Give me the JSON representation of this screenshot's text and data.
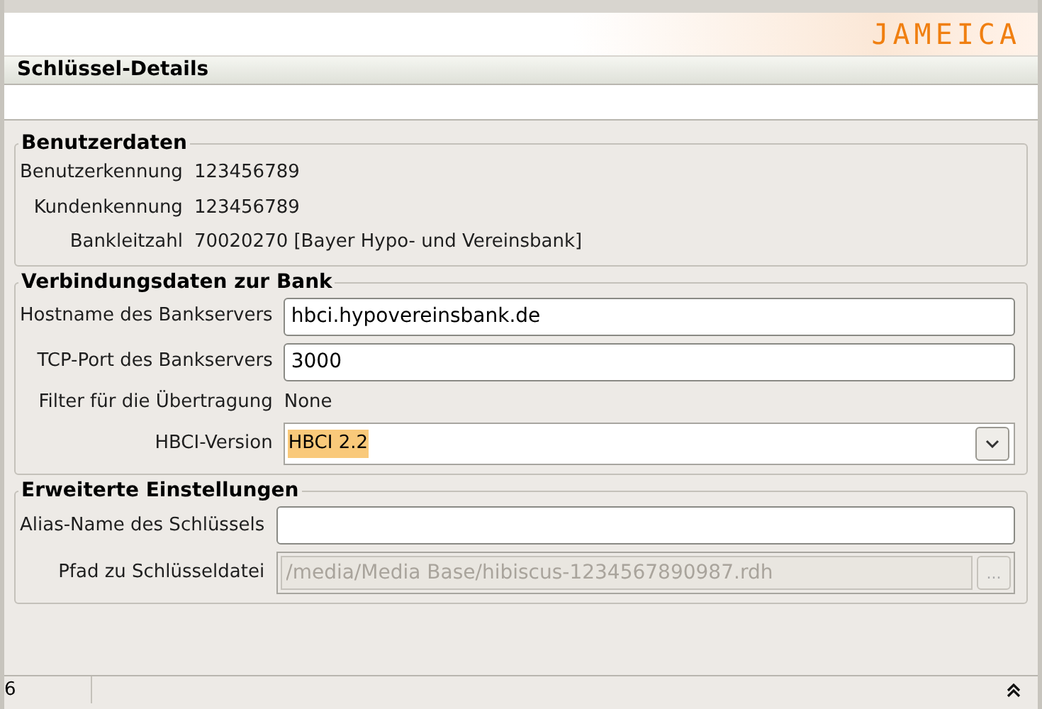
{
  "header": {
    "logo": "JAMEICA"
  },
  "title": "Schlüssel-Details",
  "groups": [
    {
      "title": "Benutzerdaten",
      "rows": [
        {
          "kind": "text",
          "label": "Benutzerkennung",
          "value": "123456789"
        },
        {
          "kind": "text",
          "label": "Kundenkennung",
          "value": "123456789"
        },
        {
          "kind": "text",
          "label": "Bankleitzahl",
          "value": "70020270 [Bayer Hypo- und Vereinsbank]"
        }
      ]
    },
    {
      "title": "Verbindungsdaten zur Bank",
      "rows": [
        {
          "kind": "input",
          "label": "Hostname des Bankservers",
          "value": "hbci.hypovereinsbank.de"
        },
        {
          "kind": "input",
          "label": "TCP-Port des Bankservers",
          "value": "3000"
        },
        {
          "kind": "text",
          "label": "Filter für die Übertragung",
          "value": "None"
        },
        {
          "kind": "select",
          "label": "HBCI-Version",
          "value": "HBCI 2.2",
          "highlighted": true
        }
      ]
    },
    {
      "title": "Erweiterte Einstellungen",
      "rows": [
        {
          "kind": "input",
          "label": "Alias-Name des Schlüssels",
          "value": ""
        },
        {
          "kind": "file",
          "label": "Pfad zu Schlüsseldatei",
          "value": "/media/Media Base/hibiscus-1234567890987.rdh",
          "disabled": true,
          "button": "..."
        }
      ]
    }
  ],
  "status_bar": {
    "text": "6"
  }
}
